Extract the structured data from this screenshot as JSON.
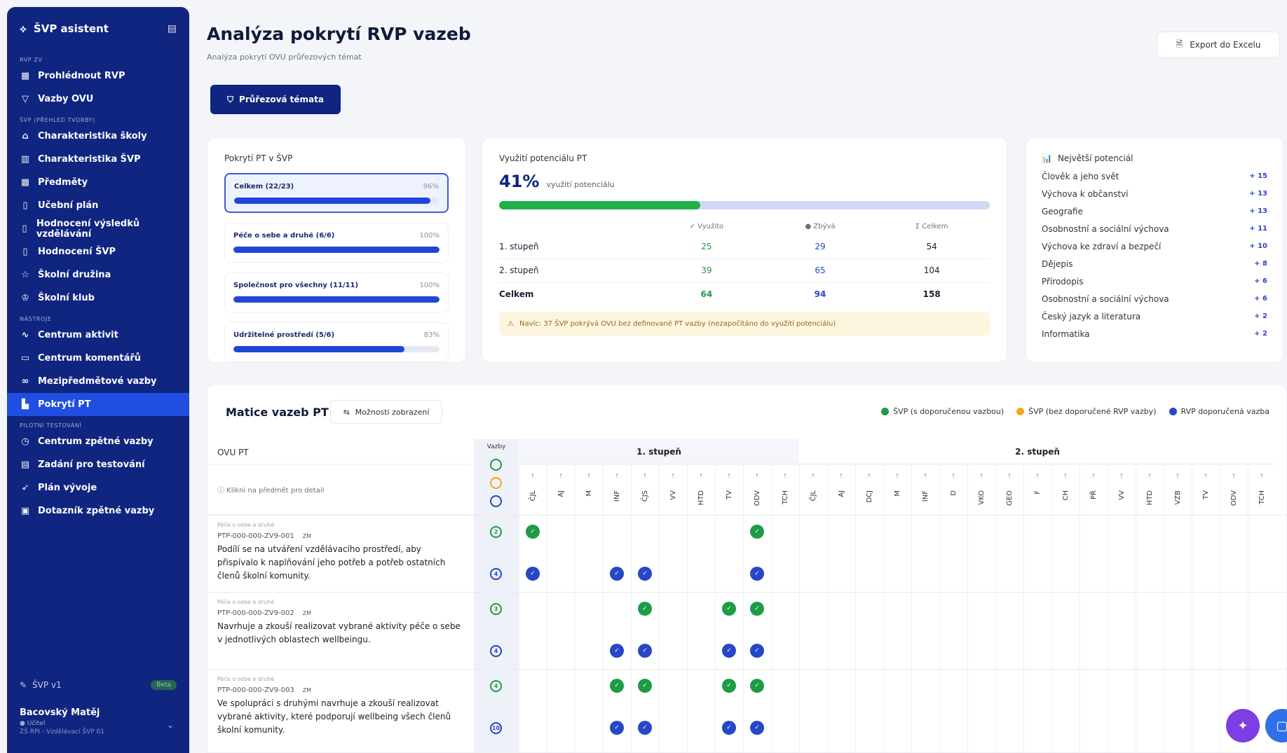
{
  "app": {
    "title": "ŠVP asistent"
  },
  "sidebar": {
    "sections": [
      {
        "label": "RVP ZV",
        "items": [
          {
            "label": "Prohlédnout RVP",
            "icon": "grid-icon"
          },
          {
            "label": "Vazby OVU",
            "icon": "filter-icon"
          }
        ]
      },
      {
        "label": "ŠVP (přehled tvorby)",
        "items": [
          {
            "label": "Charakteristika školy",
            "icon": "building-icon"
          },
          {
            "label": "Charakteristika ŠVP",
            "icon": "book-icon"
          },
          {
            "label": "Předměty",
            "icon": "grid-icon"
          },
          {
            "label": "Učební plán",
            "icon": "document-icon"
          },
          {
            "label": "Hodnocení výsledků vzdělávání",
            "icon": "document-icon"
          },
          {
            "label": "Hodnocení ŠVP",
            "icon": "document-icon"
          },
          {
            "label": "Školní družina",
            "icon": "star-icon"
          },
          {
            "label": "Školní klub",
            "icon": "badge-icon"
          }
        ]
      },
      {
        "label": "Nástroje",
        "items": [
          {
            "label": "Centrum aktivit",
            "icon": "activity-icon"
          },
          {
            "label": "Centrum komentářů",
            "icon": "comment-icon"
          },
          {
            "label": "Mezipředmětové vazby",
            "icon": "link-icon"
          },
          {
            "label": "Pokrytí PT",
            "icon": "chart-icon",
            "active": true
          }
        ]
      },
      {
        "label": "Pilotní testování",
        "items": [
          {
            "label": "Centrum zpětné vazby",
            "icon": "feedback-icon"
          },
          {
            "label": "Zadání pro testování",
            "icon": "clipboard-icon"
          },
          {
            "label": "Plán vývoje",
            "icon": "rocket-icon"
          },
          {
            "label": "Dotazník zpětné vazby",
            "icon": "form-icon"
          }
        ]
      }
    ],
    "version": {
      "label": "ŠVP v1",
      "badge": "Beta"
    },
    "user": {
      "name": "Bacovský Matěj",
      "role": "● Učitel",
      "org": "ZŠ RPI - Vzdělávací ŠVP 01"
    }
  },
  "header": {
    "title": "Analýza pokrytí RVP vazeb",
    "subtitle": "Analýza pokrytí OVU průřezových témat",
    "export_label": "Export do Excelu",
    "pt_button_label": "Průřezová témata"
  },
  "coverage": {
    "title": "Pokrytí PT v ŠVP",
    "items": [
      {
        "label": "Celkem (22/23)",
        "pct": "96%",
        "value": 0.96,
        "selected": true
      },
      {
        "label": "Péče o sebe a druhé (6/6)",
        "pct": "100%",
        "value": 1.0
      },
      {
        "label": "Společnost pro všechny (11/11)",
        "pct": "100%",
        "value": 1.0
      },
      {
        "label": "Udržitelné prostředí (5/6)",
        "pct": "83%",
        "value": 0.83
      }
    ]
  },
  "potential": {
    "title": "Využití potenciálu PT",
    "percent": "41%",
    "percent_label": "využití potenciálu",
    "value": 0.41,
    "columns": [
      "✓ Využito",
      "● Zbývá",
      "Σ Celkem"
    ],
    "rows": [
      {
        "label": "1. stupeň",
        "used": "25",
        "left": "29",
        "total": "54"
      },
      {
        "label": "2. stupeň",
        "used": "39",
        "left": "65",
        "total": "104"
      },
      {
        "label": "Celkem",
        "used": "64",
        "left": "94",
        "total": "158"
      }
    ],
    "note": "Navíc: 37 ŠVP pokrývá OVU bez definované PT vazby (nezapočítáno do využití potenciálu)"
  },
  "top_potential": {
    "title": "Největší potenciál",
    "items": [
      {
        "label": "Člověk a jeho svět",
        "count": "+ 15"
      },
      {
        "label": "Výchova k občanství",
        "count": "+ 13"
      },
      {
        "label": "Geografie",
        "count": "+ 13"
      },
      {
        "label": "Osobnostní a sociální výchova",
        "count": "+ 11"
      },
      {
        "label": "Výchova ke zdraví a bezpečí",
        "count": "+ 10"
      },
      {
        "label": "Dějepis",
        "count": "+ 8"
      },
      {
        "label": "Přírodopis",
        "count": "+ 6"
      },
      {
        "label": "Osobnostní a sociální výchova",
        "count": "+ 6"
      },
      {
        "label": "Český jazyk a literatura",
        "count": "+ 2"
      },
      {
        "label": "Informatika",
        "count": "+ 2"
      }
    ]
  },
  "matrix": {
    "title": "Matice vazeb PT",
    "options_label": "Možnosti zobrazení",
    "legend": [
      {
        "label": "ŠVP (s doporučenou vazbou)",
        "color": "#1e9b46"
      },
      {
        "label": "ŠVP (bez doporučené RVP vazby)",
        "color": "#f2a81d"
      },
      {
        "label": "RVP doporučená vazba",
        "color": "#2747c7"
      }
    ],
    "col_header": "OVU PT",
    "click_hint": "ⓘ Klikni na předmět pro detail",
    "vazby_label": "Vazby",
    "group1": "1. stupeň",
    "group2": "2. stupeň",
    "subjects1": [
      "ČJL",
      "AJ",
      "M",
      "INF",
      "ČJS",
      "VV",
      "HTD",
      "TV",
      "ODV",
      "TCH"
    ],
    "subjects2": [
      "ČJL",
      "AJ",
      "DCJ",
      "M",
      "INF",
      "D",
      "VKO",
      "GEO",
      "F",
      "CH",
      "PŘ",
      "VV",
      "HTD",
      "VZB",
      "TV",
      "ODV",
      "TCH"
    ],
    "rows": [
      {
        "cat": "Péče o sebe a druhé",
        "code": "PTP-000-000-ZV9-001",
        "tag": "ZM",
        "desc": "Podílí se na utváření vzdělávacího prostředí, aby přispívalo k naplňování jeho potřeb a potřeb ostatních členů školní komunity.",
        "svp": "2",
        "rvp": "4"
      },
      {
        "cat": "Péče o sebe a druhé",
        "code": "PTP-000-000-ZV9-002",
        "tag": "ZM",
        "desc": "Navrhuje a zkouší realizovat vybrané aktivity péče o sebe v jednotlivých oblastech wellbeingu.",
        "svp": "3",
        "rvp": "4"
      },
      {
        "cat": "Péče o sebe a druhé",
        "code": "PTP-000-000-ZV9-003",
        "tag": "ZM",
        "desc": "Ve spolupráci s druhými navrhuje a zkouší realizovat vybrané aktivity, které podporují wellbeing všech členů školní komunity.",
        "svp": "4",
        "rvp": "10"
      }
    ]
  }
}
